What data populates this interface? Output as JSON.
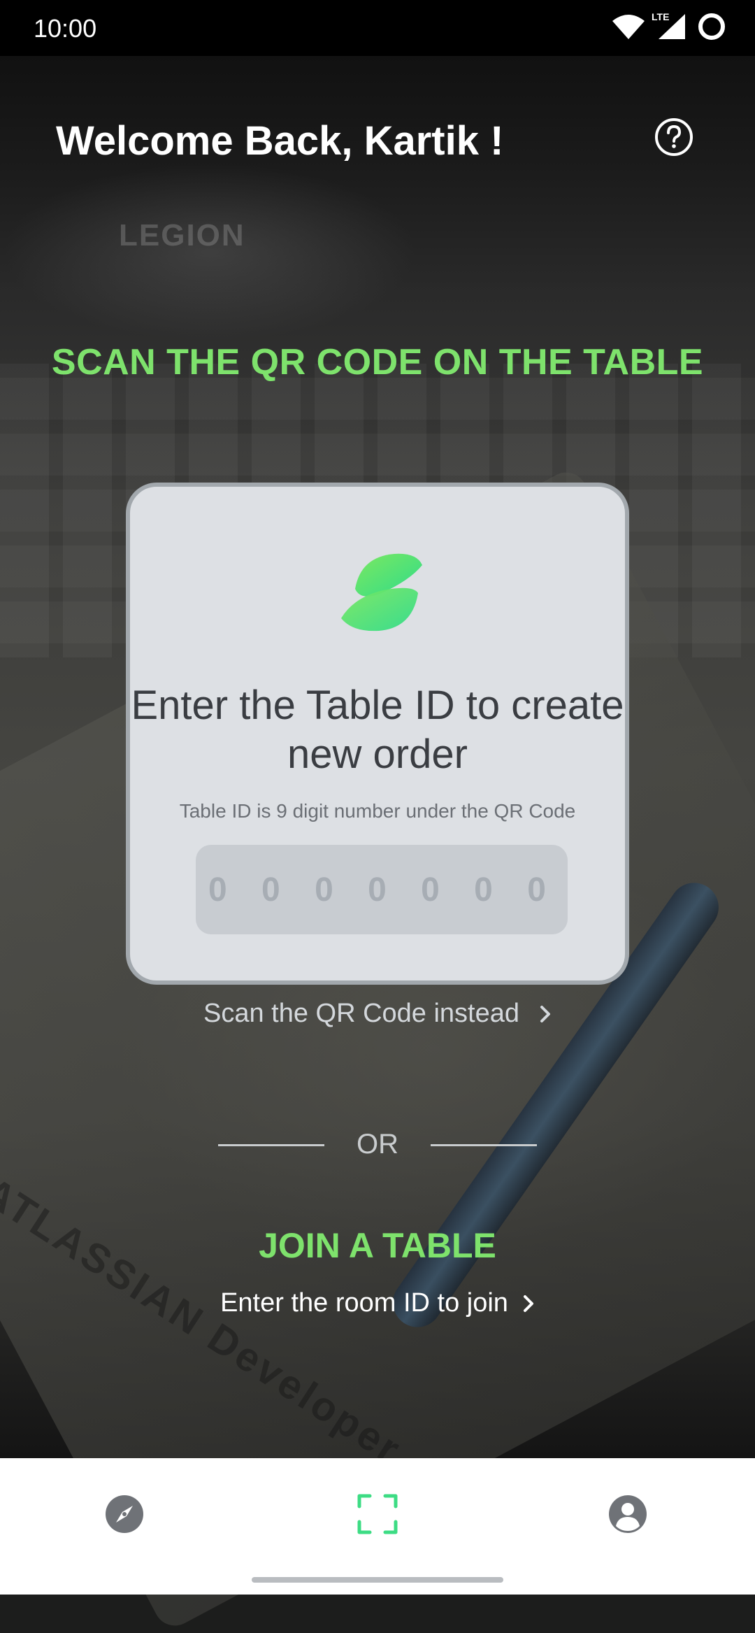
{
  "status_bar": {
    "time": "10:00",
    "network": "LTE",
    "icons": [
      "wifi-icon",
      "signal-icon",
      "battery-icon"
    ]
  },
  "header": {
    "welcome": "Welcome Back, Kartik !",
    "help_icon": "help-circle-icon"
  },
  "scan": {
    "title": "SCAN THE QR CODE ON THE TABLE"
  },
  "card": {
    "title": "Enter the Table ID to create new order",
    "hint": "Table ID is 9 digit number under the QR Code",
    "table_id_placeholder": "0 0 0 0 0 0 0 0 0",
    "table_id_value": ""
  },
  "scan_instead": {
    "label": "Scan the QR Code instead",
    "icon": "chevron-right-icon"
  },
  "divider": {
    "label": "OR"
  },
  "join": {
    "title": "JOIN A TABLE",
    "link": "Enter the room ID to join",
    "icon": "chevron-right-icon"
  },
  "background_text": {
    "laptop_brand": "LEGION",
    "notebook": "ATLASSIAN Developer"
  },
  "bottom_nav": {
    "items": [
      {
        "icon": "compass-icon",
        "active": false
      },
      {
        "icon": "scan-icon",
        "active": true
      },
      {
        "icon": "profile-icon",
        "active": false
      }
    ]
  },
  "colors": {
    "accent": "#7ee26c",
    "card_bg": "#dde0e4",
    "active_nav": "#3ddc84",
    "inactive_nav": "#6f7277"
  }
}
